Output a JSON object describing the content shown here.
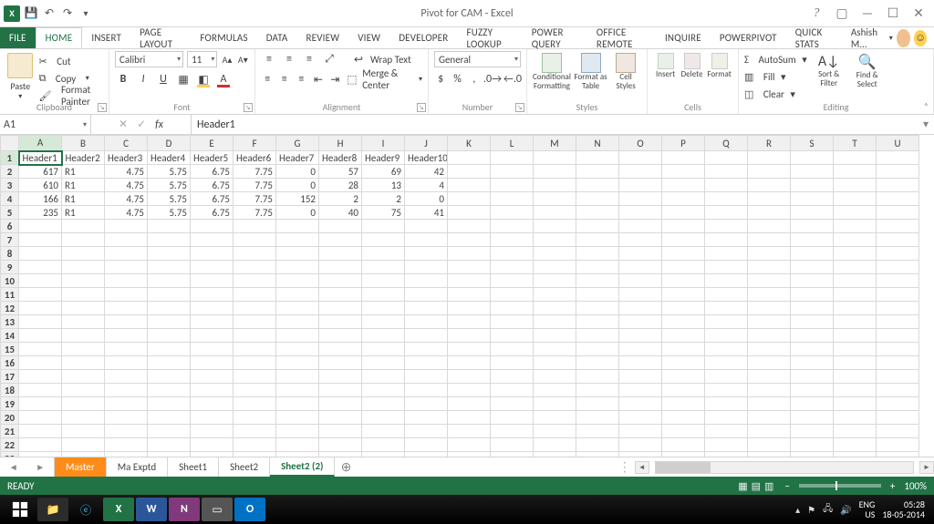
{
  "title": "Pivot for CAM - Excel",
  "user_name": "Ashish M...",
  "tabs": [
    "FILE",
    "HOME",
    "INSERT",
    "PAGE LAYOUT",
    "FORMULAS",
    "DATA",
    "REVIEW",
    "VIEW",
    "DEVELOPER",
    "Fuzzy Lookup",
    "POWER QUERY",
    "OFFICE REMOTE",
    "INQUIRE",
    "POWERPIVOT",
    "QUICK STATS"
  ],
  "ribbon": {
    "clipboard": {
      "paste": "Paste",
      "cut": "Cut",
      "copy": "Copy",
      "fmt": "Format Painter",
      "label": "Clipboard"
    },
    "font": {
      "name": "Calibri",
      "size": "11",
      "label": "Font"
    },
    "alignment": {
      "wrap": "Wrap Text",
      "merge": "Merge & Center",
      "label": "Alignment"
    },
    "number": {
      "format": "General",
      "label": "Number"
    },
    "styles": {
      "cond": "Conditional Formatting",
      "table": "Format as Table",
      "cell": "Cell Styles",
      "label": "Styles"
    },
    "cells": {
      "insert": "Insert",
      "delete": "Delete",
      "format": "Format",
      "label": "Cells"
    },
    "editing": {
      "autosum": "AutoSum",
      "fill": "Fill",
      "clear": "Clear",
      "sort": "Sort & Filter",
      "find": "Find & Select",
      "label": "Editing"
    }
  },
  "namebox": "A1",
  "formula": "Header1",
  "columns": [
    "A",
    "B",
    "C",
    "D",
    "E",
    "F",
    "G",
    "H",
    "I",
    "J",
    "K",
    "L",
    "M",
    "N",
    "O",
    "P",
    "Q",
    "R",
    "S",
    "T",
    "U"
  ],
  "active_cell": {
    "row": 1,
    "col": 0
  },
  "data_rows": [
    [
      "Header1",
      "Header2",
      "Header3",
      "Header4",
      "Header5",
      "Header6",
      "Header7",
      "Header8",
      "Header9",
      "Header10"
    ],
    [
      "617",
      "R1",
      "4.75",
      "5.75",
      "6.75",
      "7.75",
      "0",
      "57",
      "69",
      "42"
    ],
    [
      "610",
      "R1",
      "4.75",
      "5.75",
      "6.75",
      "7.75",
      "0",
      "28",
      "13",
      "4"
    ],
    [
      "166",
      "R1",
      "4.75",
      "5.75",
      "6.75",
      "7.75",
      "152",
      "2",
      "2",
      "0"
    ],
    [
      "235",
      "R1",
      "4.75",
      "5.75",
      "6.75",
      "7.75",
      "0",
      "40",
      "75",
      "41"
    ]
  ],
  "row_count": 23,
  "sheets": [
    {
      "name": "Master",
      "cls": "master"
    },
    {
      "name": "Ma Exptd",
      "cls": ""
    },
    {
      "name": "Sheet1",
      "cls": ""
    },
    {
      "name": "Sheet2",
      "cls": ""
    },
    {
      "name": "Sheet2 (2)",
      "cls": "active"
    }
  ],
  "status": {
    "ready": "READY",
    "zoom": "100%"
  },
  "taskbar": {
    "lang": "ENG",
    "locale": "US",
    "time": "05:28",
    "date": "18-05-2014"
  }
}
